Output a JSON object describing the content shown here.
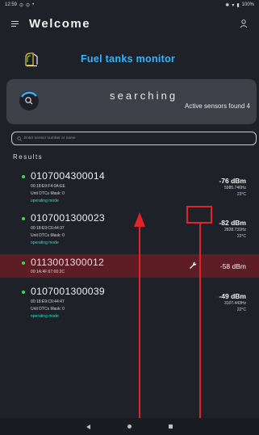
{
  "status_bar": {
    "time": "12:59",
    "battery": "100%"
  },
  "app_bar": {
    "title": "Welcome"
  },
  "header": {
    "title": "Fuel tanks monitor"
  },
  "search_card": {
    "status": "searching",
    "active_label": "Active sensors found",
    "active_count": "4"
  },
  "search": {
    "placeholder": "Enter sensor number or name"
  },
  "results_label": "Results",
  "sensors": [
    {
      "id": "0107004300014",
      "mac": "00:18:E9:F4:0A:EE",
      "dtc": "Unit DTCs Mask: 0",
      "mode": "operating mode",
      "dbm": "-76 dBm",
      "freq": "5985.746Hz",
      "temp": "23°C"
    },
    {
      "id": "0107001300023",
      "mac": "00:18:E9:C6:44:37",
      "dtc": "Unit DTCs Mask: 0",
      "mode": "operating mode",
      "dbm": "-82 dBm",
      "freq": "2828.731Hz",
      "temp": "22°C"
    },
    {
      "id": "0113001300012",
      "mac": "00:1A:4F:67:00:2C",
      "dbm": "-58 dBm"
    },
    {
      "id": "0107001300039",
      "mac": "00:18:E9:C6:44:47",
      "dtc": "Unit DTCs Mask: 0",
      "mode": "operating mode",
      "dbm": "-49 dBm",
      "freq": "3107.443Hz",
      "temp": "22°C"
    }
  ],
  "colors": {
    "accent": "#35b4ff",
    "online": "#2ee05a",
    "selected_row": "#5e1d25",
    "annotation": "#e3222a"
  }
}
